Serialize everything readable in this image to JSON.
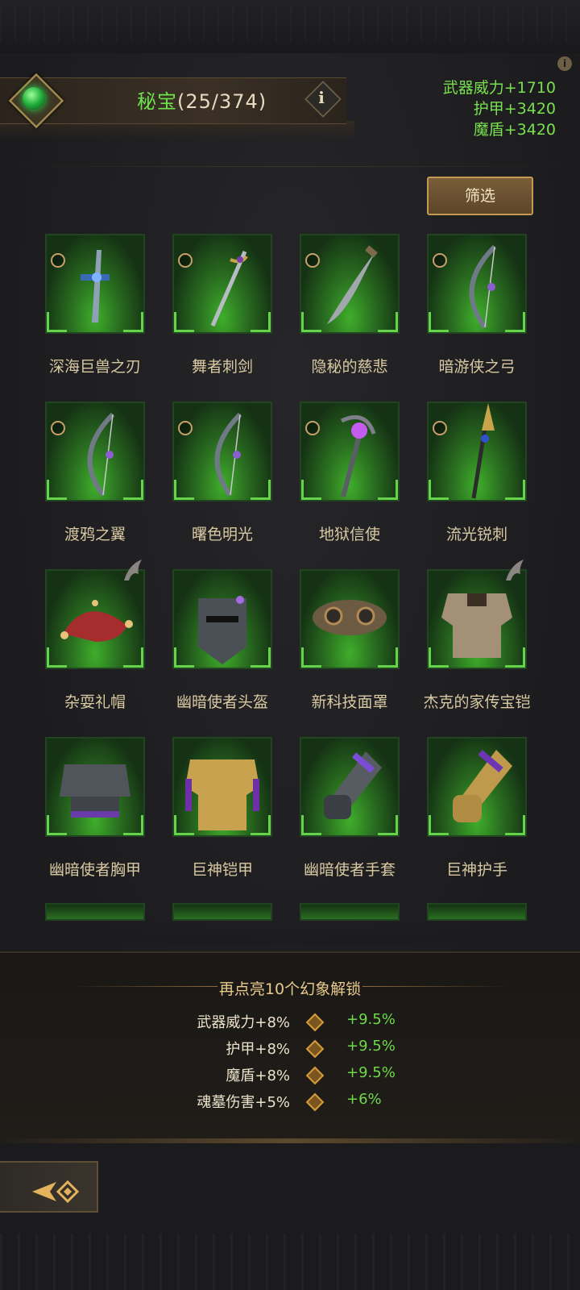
{
  "header": {
    "name": "秘宝",
    "count": "(25/374)",
    "info_glyph": "i"
  },
  "stats": [
    "武器威力+1710",
    "护甲+3420",
    "魔盾+3420"
  ],
  "filter_label": "筛选",
  "items": [
    {
      "label": "深海巨兽之刃",
      "icon": "sword-icon",
      "selectable": true
    },
    {
      "label": "舞者刺剑",
      "icon": "rapier-icon",
      "selectable": true
    },
    {
      "label": "隐秘的慈悲",
      "icon": "curved-blade-icon",
      "selectable": true
    },
    {
      "label": "暗游侠之弓",
      "icon": "bow-icon",
      "selectable": true
    },
    {
      "label": "渡鸦之翼",
      "icon": "bow-icon",
      "selectable": true
    },
    {
      "label": "曙色明光",
      "icon": "bow-icon",
      "selectable": true
    },
    {
      "label": "地狱信使",
      "icon": "scythe-staff-icon",
      "selectable": true
    },
    {
      "label": "流光锐刺",
      "icon": "spear-icon",
      "selectable": true
    },
    {
      "label": "杂耍礼帽",
      "icon": "jester-hat-icon",
      "selectable": false,
      "badge": true
    },
    {
      "label": "幽暗使者头盔",
      "icon": "helmet-icon",
      "selectable": false
    },
    {
      "label": "新科技面罩",
      "icon": "mask-icon",
      "selectable": false
    },
    {
      "label": "杰克的家传宝铠",
      "icon": "armor-icon",
      "selectable": false,
      "badge": true
    },
    {
      "label": "幽暗使者胸甲",
      "icon": "chestplate-icon",
      "selectable": false
    },
    {
      "label": "巨神铠甲",
      "icon": "golden-armor-icon",
      "selectable": false
    },
    {
      "label": "幽暗使者手套",
      "icon": "gauntlet-icon",
      "selectable": false
    },
    {
      "label": "巨神护手",
      "icon": "golden-gauntlet-icon",
      "selectable": false
    }
  ],
  "unlock": {
    "title": "再点亮10个幻象解锁",
    "rows": [
      {
        "current": "武器威力+8%",
        "next": "+9.5%"
      },
      {
        "current": "护甲+8%",
        "next": "+9.5%"
      },
      {
        "current": "魔盾+8%",
        "next": "+9.5%"
      },
      {
        "current": "魂墓伤害+5%",
        "next": "+6%"
      }
    ]
  },
  "colors": {
    "accent_green": "#6ee24b",
    "gold": "#c49a52"
  }
}
